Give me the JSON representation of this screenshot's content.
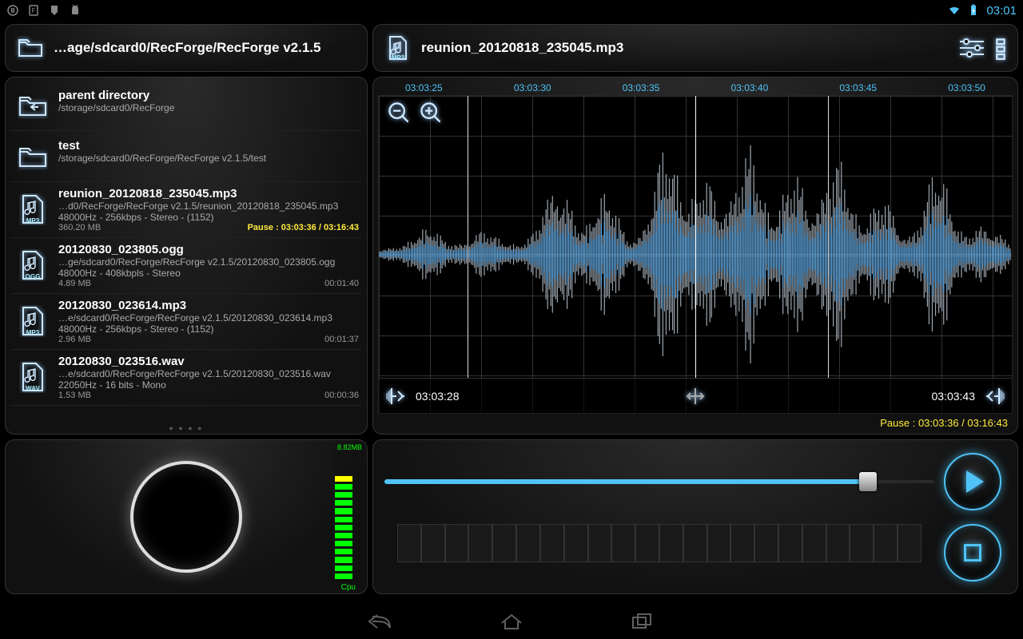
{
  "statusbar": {
    "time": "03:01"
  },
  "left_header": {
    "path": "…age/sdcard0/RecForge/RecForge v2.1.5"
  },
  "right_header": {
    "filename": "reunion_20120818_235045.mp3"
  },
  "dirs": [
    {
      "name": "parent directory",
      "path": "/storage/sdcard0/RecForge"
    },
    {
      "name": "test",
      "path": "/storage/sdcard0/RecForge/RecForge v2.1.5/test"
    }
  ],
  "files": [
    {
      "badge": "MP3",
      "name": "reunion_20120818_235045.mp3",
      "path": "…d0/RecForge/RecForge v2.1.5/reunion_20120818_235045.mp3",
      "meta": "48000Hz - 256kbps - Stereo - (1152)",
      "size": "360.20 MB",
      "status": "Pause : 03:03:36 / 03:16:43",
      "duration": ""
    },
    {
      "badge": "OGG",
      "name": "20120830_023805.ogg",
      "path": "…ge/sdcard0/RecForge/RecForge v2.1.5/20120830_023805.ogg",
      "meta": "48000Hz - 408kbpls - Stereo",
      "size": "4.89 MB",
      "status": "",
      "duration": "00:01:40"
    },
    {
      "badge": "MP3",
      "name": "20120830_023614.mp3",
      "path": "…e/sdcard0/RecForge/RecForge v2.1.5/20120830_023614.mp3",
      "meta": "48000Hz - 256kbps - Stereo - (1152)",
      "size": "2.96 MB",
      "status": "",
      "duration": "00:01:37"
    },
    {
      "badge": "WAV",
      "name": "20120830_023516.wav",
      "path": "…e/sdcard0/RecForge/RecForge v2.1.5/20120830_023516.wav",
      "meta": "22050Hz - 16 bits - Mono",
      "size": "1.53 MB",
      "status": "",
      "duration": "00:00:36"
    }
  ],
  "ruler": [
    "03:03:25",
    "03:03:30",
    "03:03:35",
    "03:03:40",
    "03:03:45",
    "03:03:50"
  ],
  "selection": {
    "start": "03:03:28",
    "end": "03:03:43"
  },
  "pause_line": "Pause : 03:03:36 / 03:16:43",
  "meter": {
    "top": "8.82MB",
    "bottom": "Cpu"
  },
  "seek": {
    "percent": 88
  }
}
